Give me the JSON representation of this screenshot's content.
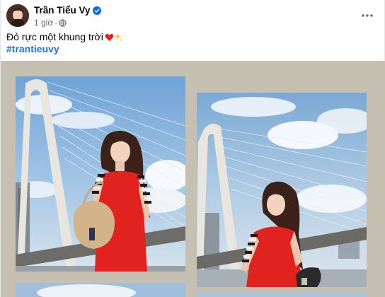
{
  "post": {
    "author": "Trần Tiểu Vy",
    "time": "1 giờ",
    "separator": "·",
    "caption": "Đỏ rực một khung trời",
    "hashtag": "#trantieuvy",
    "icons": {
      "verified": "verified-badge-icon",
      "privacy": "globe-icon",
      "more": "more-options-icon",
      "heart": "red-heart-emoji",
      "sparkles": "sparkles-emoji"
    },
    "colors": {
      "verified": "#0866ff",
      "hashtag": "#1b74e4",
      "media_background": "#c6c0b2",
      "dress": "#e0231f"
    }
  }
}
